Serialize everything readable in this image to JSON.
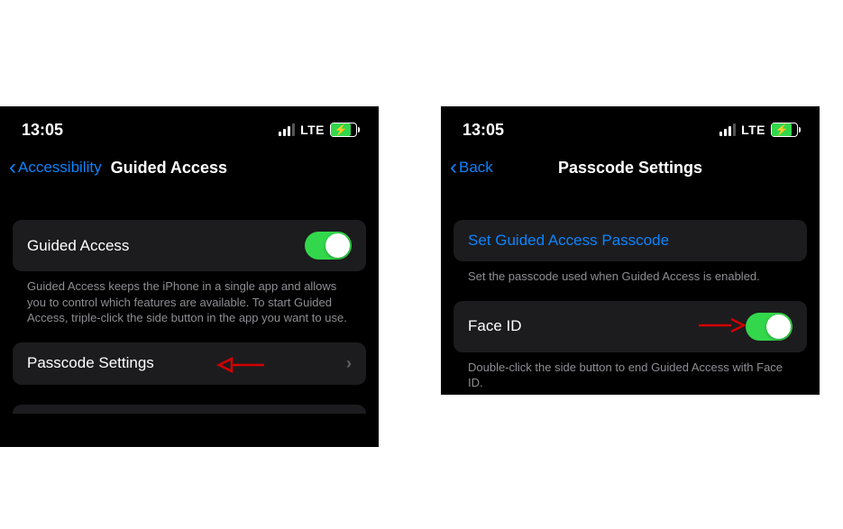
{
  "status": {
    "time": "13:05",
    "network": "LTE"
  },
  "left": {
    "back_label": "Accessibility",
    "title": "Guided Access",
    "rows": {
      "guided_access": {
        "label": "Guided Access"
      },
      "passcode_settings": {
        "label": "Passcode Settings"
      }
    },
    "footer_guided": "Guided Access keeps the iPhone in a single app and allows you to control which features are available. To start Guided Access, triple-click the side button in the app you want to use."
  },
  "right": {
    "back_label": "Back",
    "title": "Passcode Settings",
    "rows": {
      "set_passcode": {
        "label": "Set Guided Access Passcode"
      },
      "face_id": {
        "label": "Face ID"
      }
    },
    "footer_set": "Set the passcode used when Guided Access is enabled.",
    "footer_faceid": "Double-click the side button to end Guided Access with Face ID."
  }
}
